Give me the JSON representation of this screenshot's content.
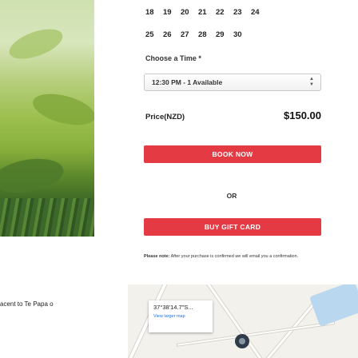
{
  "calendar": {
    "row1": [
      "18",
      "19",
      "20",
      "21",
      "22",
      "23",
      "24"
    ],
    "row2": [
      "25",
      "26",
      "27",
      "28",
      "29",
      "30"
    ]
  },
  "time": {
    "label": "Choose a Time *",
    "selected": "12:30 PM - 1 Available"
  },
  "price": {
    "label": "Price(NZD)",
    "value": "$150.00"
  },
  "buttons": {
    "book": "BOOK NOW",
    "or": "OR",
    "gift": "BUY GIFT CARD"
  },
  "note": {
    "bold": "Please note:",
    "text": " After your purchase is confirmed we will email you a confirmation."
  },
  "map": {
    "coords": "37°38'14.7\"S...",
    "larger_link": "View larger map"
  },
  "adjacent_text": "acent to Te Papa o",
  "colors": {
    "accent_red": "#e43a43"
  }
}
